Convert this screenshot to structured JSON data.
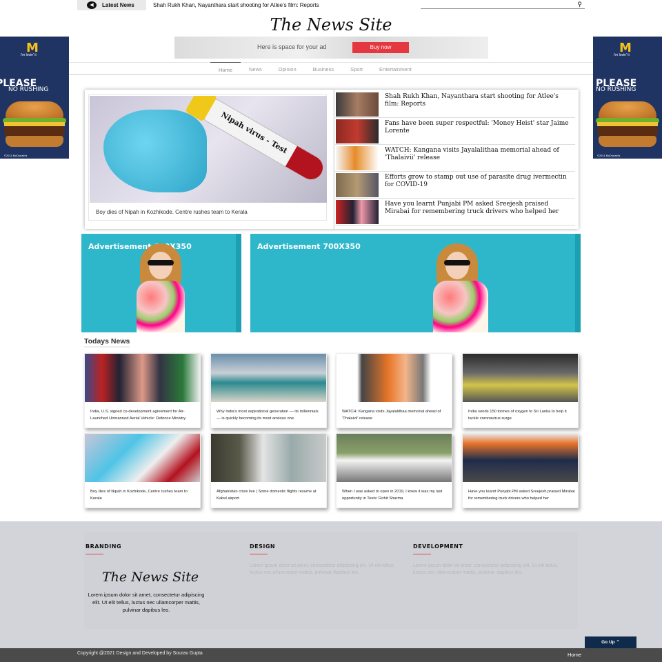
{
  "ticker": {
    "badge": "Latest News",
    "text": "Shah Rukh Khan, Nayanthara start shooting for Atlee's film: Reports"
  },
  "site": {
    "title": "The News Site"
  },
  "top_ad": {
    "text": "Here is space for your ad",
    "button": "Buy now"
  },
  "nav": {
    "items": [
      "Home",
      "News",
      "Opinion",
      "Business",
      "Sport",
      "Entertainment"
    ],
    "active": "Home"
  },
  "side_ad": {
    "brand": "M",
    "tagline": "i'm lovin' it",
    "headline": "PLEASE",
    "subline": "NO RUSHING",
    "fine_print": "©2011 McDonald's"
  },
  "feature": {
    "caption": "Boy dies of Nipah in Kozhikode. Centre rushes team to Kerala",
    "tube_label": "Nipah virus - Test",
    "headlines": [
      "Shah Rukh Khan, Nayanthara start shooting for Atlee's film: Reports",
      "Fans have been super respectful: 'Money Heist' star Jaime Lorente",
      "WATCH: Kangana visits Jayalalithaa memorial ahead of 'Thalaivii' release",
      "Efforts grow to stamp out use of parasite drug ivermectin for COVID-19",
      "Have you learnt Punjabi PM asked Sreejesh praised Mirabai for remembering truck drivers who helped her"
    ]
  },
  "ads": {
    "left": "Advertisement 600X350",
    "right": "Advertisement 700X350"
  },
  "todays": {
    "title": "Todays News",
    "cards": [
      "India, U.S. signed co-development agreement for Air-Launched Unmanned Aerial Vehicle: Defence Ministry",
      "Why India's most aspirational generation — its millennials — is quickly becoming its most anxious one",
      "WATCH: Kangana visits Jayalalithaa memorial ahead of 'Thalaivii' release",
      "India sends 150 tonnes of oxygen to Sri Lanka to help it tackle coronavirus surge",
      "Boy dies of Nipah in Kozhikode, Centre rushes team to Kerala",
      "Afghanistan crisis live | Some domestic flights resume at Kabul airport",
      "When I was asked to open in 2019, I knew it was my last opportunity in Tests: Rohit Sharma",
      "Have you learnt Punjabi PM asked Sreejesh praised Mirabai for remembering truck drivers who helped her"
    ]
  },
  "footer": {
    "branding": "BRANDING",
    "design": "DESIGN",
    "development": "DEVELOPMENT",
    "logo": "The News Site",
    "brand_text": "Lorem ipsum dolor sit amet, consectetur adipiscing elit. Ut elit tellus, luctus nec ullamcorper mattis, pulvinar dapibus leo.",
    "design_text": "Lorem ipsum dolor sit amet, consectetur adipiscing elit. Ut elit tellus, luctus nec ullamcorper mattis, pulvinar dapibus leo.",
    "dev_text": "Lorem ipsum dolor sit amet, consectetur adipiscing elit. Ut elit tellus, luctus nec ullamcorper mattis, pulvinar dapibus leo.",
    "go_up": "Go Up  ⌃",
    "copyright": "Copyright @2021 Design and Developed by Sourav Gupta",
    "home": "Home"
  },
  "colors": {
    "accent": "#e5373f",
    "nav_dark": "#0f2a4a",
    "ad_bg": "#2eb7cb",
    "side_ad_bg": "#203463"
  }
}
